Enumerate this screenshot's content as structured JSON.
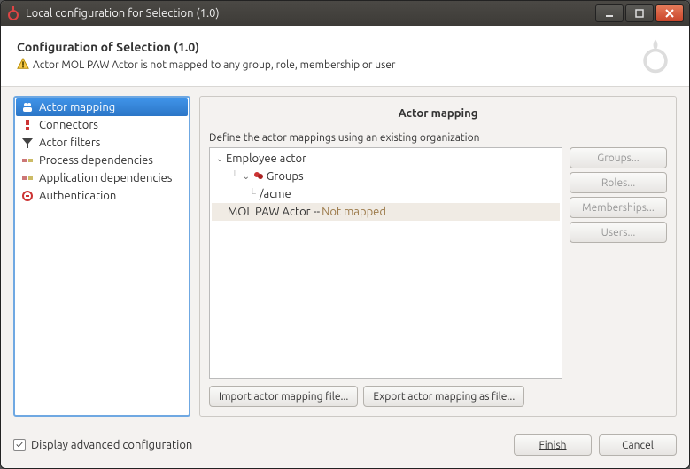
{
  "window": {
    "title": "Local configuration for Selection (1.0)"
  },
  "header": {
    "title": "Configuration of Selection (1.0)",
    "warning": "Actor MOL PAW Actor is not mapped to any group, role, membership or user"
  },
  "sidebar": {
    "items": [
      {
        "label": "Actor mapping",
        "icon": "actors-icon",
        "selected": true
      },
      {
        "label": "Connectors",
        "icon": "connector-icon",
        "selected": false
      },
      {
        "label": "Actor filters",
        "icon": "filter-icon",
        "selected": false
      },
      {
        "label": "Process dependencies",
        "icon": "dependency-icon",
        "selected": false
      },
      {
        "label": "Application dependencies",
        "icon": "dependency-icon",
        "selected": false
      },
      {
        "label": "Authentication",
        "icon": "auth-icon",
        "selected": false
      }
    ]
  },
  "main": {
    "title": "Actor mapping",
    "description": "Define the actor mappings using an existing organization",
    "tree": [
      {
        "level": 0,
        "expanded": true,
        "icon": "",
        "label": "Employee actor",
        "note": ""
      },
      {
        "level": 1,
        "expanded": true,
        "icon": "group-icon",
        "label": "Groups",
        "note": ""
      },
      {
        "level": 2,
        "expanded": false,
        "icon": "",
        "label": "/acme",
        "note": ""
      },
      {
        "level": 0,
        "expanded": false,
        "icon": "",
        "label": "MOL PAW Actor -- ",
        "note": "Not mapped",
        "selected": true
      }
    ],
    "side_buttons": {
      "groups": "Groups...",
      "roles": "Roles...",
      "memberships": "Memberships...",
      "users": "Users..."
    },
    "bottom_buttons": {
      "import": "Import actor mapping file...",
      "export": "Export actor mapping as file..."
    }
  },
  "footer": {
    "checkbox_label": "Display advanced configuration",
    "checkbox_checked": true,
    "finish": "Finish",
    "cancel": "Cancel"
  }
}
